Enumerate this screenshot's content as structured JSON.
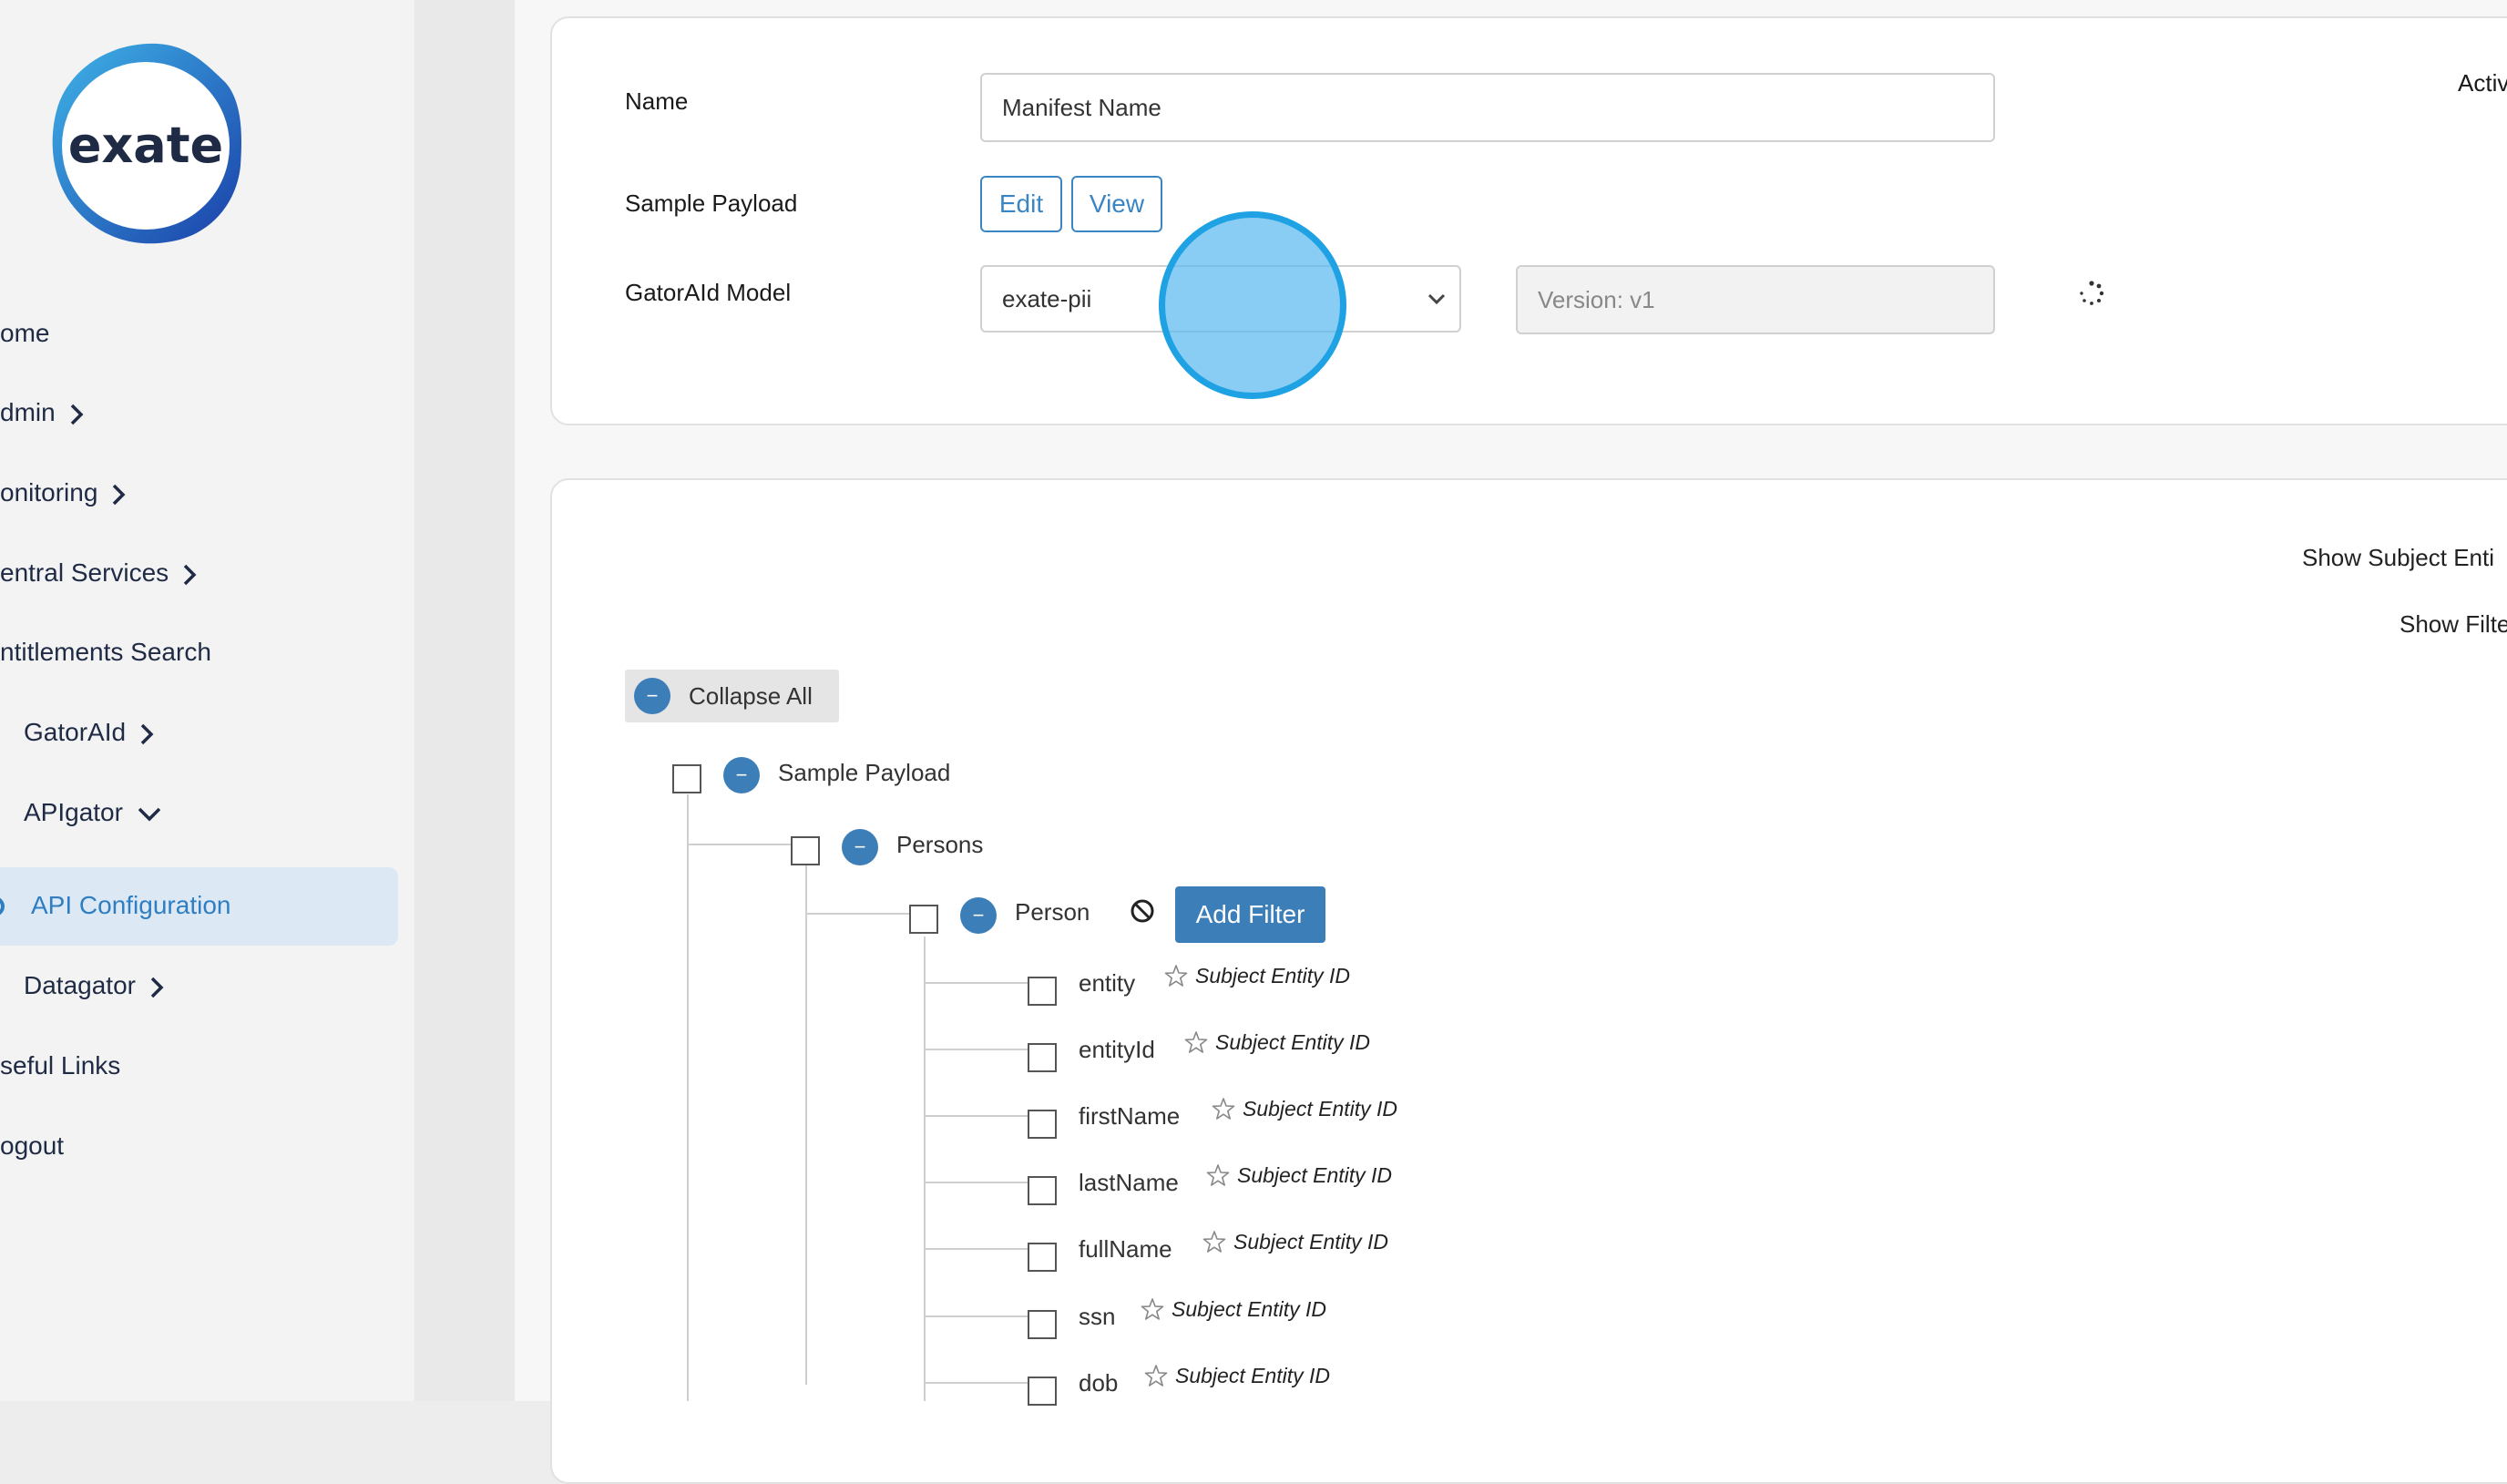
{
  "brand": {
    "logo_text": "exate",
    "accent": "#2f7ec1",
    "primary": "#3c7eb8"
  },
  "sidebar": {
    "items": [
      {
        "label": "ome",
        "chevron": false
      },
      {
        "label": "dmin",
        "chevron": "right"
      },
      {
        "label": "onitoring",
        "chevron": "right"
      },
      {
        "label": "entral Services",
        "chevron": "right"
      },
      {
        "label": "ntitlements Search",
        "chevron": false
      },
      {
        "label": "GatorAId",
        "chevron": "right"
      },
      {
        "label": "APIgator",
        "chevron": "down"
      },
      {
        "label": "API Configuration",
        "active": true
      },
      {
        "label": "Datagator",
        "chevron": "right"
      },
      {
        "label": "seful Links",
        "chevron": false
      },
      {
        "label": "ogout",
        "chevron": false
      }
    ]
  },
  "form": {
    "name_label": "Name",
    "name_value": "Manifest Name",
    "active_label": "Activ",
    "sample_payload_label": "Sample Payload",
    "edit_label": "Edit",
    "view_label": "View",
    "model_label": "GatorAId Model",
    "model_value": "exate-pii",
    "version_placeholder": "Version: v1"
  },
  "tree_panel": {
    "show_subject_label": "Show Subject Enti",
    "show_filter_label": "Show Filte",
    "collapse_all_label": "Collapse All",
    "root_label": "Sample Payload",
    "level1_label": "Persons",
    "level2_label": "Person",
    "add_filter_label": "Add Filter",
    "fields": [
      {
        "name": "entity",
        "tag": "Subject Entity ID"
      },
      {
        "name": "entityId",
        "tag": "Subject Entity ID"
      },
      {
        "name": "firstName",
        "tag": "Subject Entity ID"
      },
      {
        "name": "lastName",
        "tag": "Subject Entity ID"
      },
      {
        "name": "fullName",
        "tag": "Subject Entity ID"
      },
      {
        "name": "ssn",
        "tag": "Subject Entity ID"
      },
      {
        "name": "dob",
        "tag": "Subject Entity ID"
      }
    ]
  }
}
